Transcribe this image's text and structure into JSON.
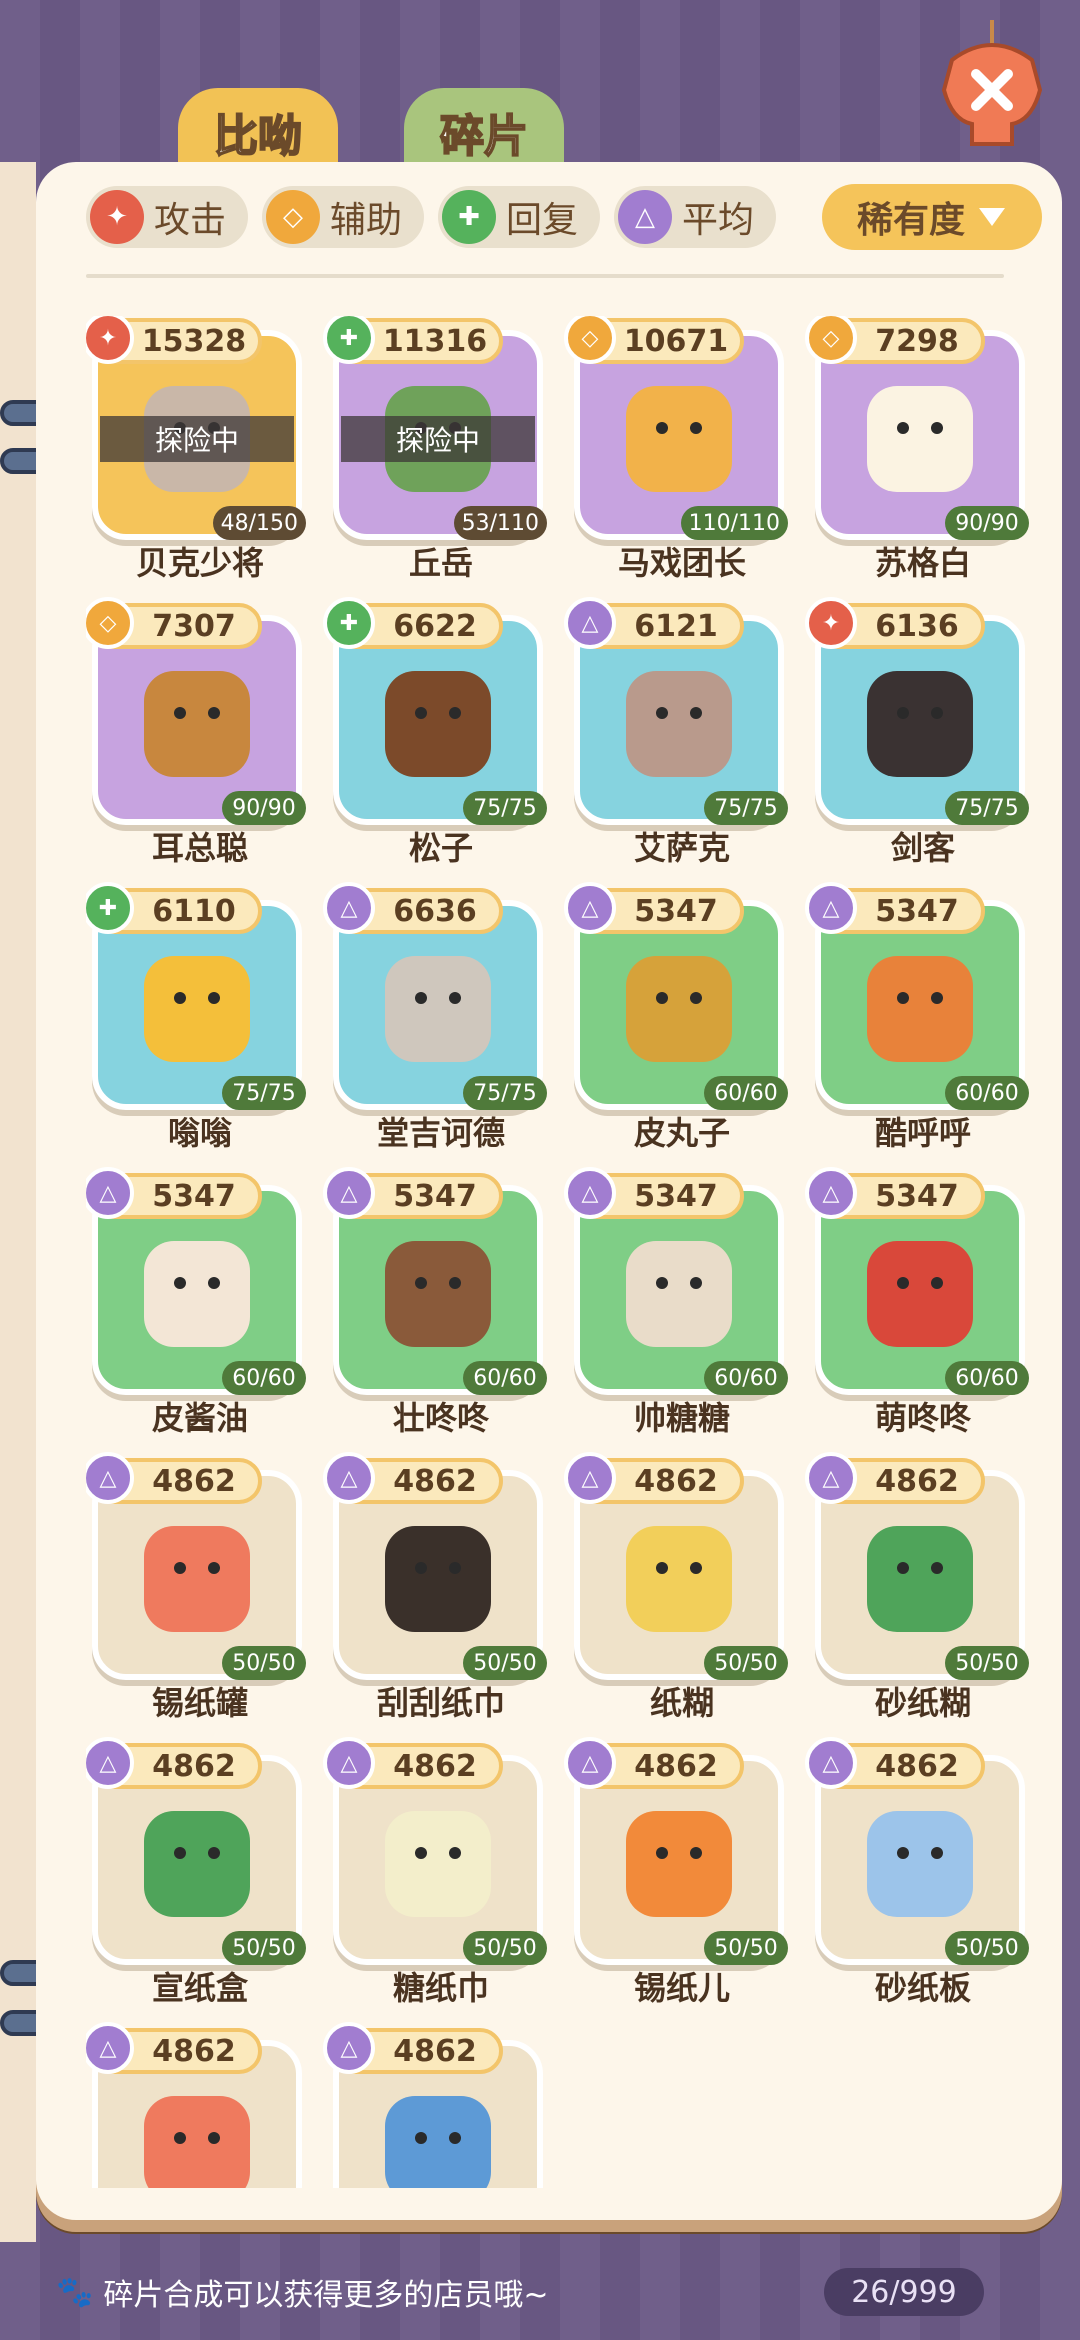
{
  "tabs": [
    {
      "label": "比呦"
    },
    {
      "label": "碎片"
    }
  ],
  "filters": [
    {
      "label": "攻击",
      "glyph": "✦",
      "color": "#e4604a"
    },
    {
      "label": "辅助",
      "glyph": "◇",
      "color": "#f0a83c"
    },
    {
      "label": "回复",
      "glyph": "✚",
      "color": "#55b25c"
    },
    {
      "label": "平均",
      "glyph": "△",
      "color": "#a17dd0"
    }
  ],
  "sort": {
    "label": "稀有度",
    "icon": "chevron-down-icon"
  },
  "close_icon": "close-icon",
  "type_colors": {
    "attack": "#e4604a",
    "support": "#f0a83c",
    "heal": "#55b25c",
    "balanced": "#a17dd0"
  },
  "type_glyphs": {
    "attack": "✦",
    "support": "◇",
    "heal": "✚",
    "balanced": "△"
  },
  "cards": [
    {
      "name": "贝克少将",
      "power": "15328",
      "type": "attack",
      "count": "48/150",
      "bg": "#f5c45a",
      "art": "#c9b7a8",
      "status": "探险中",
      "partial": true
    },
    {
      "name": "丘岳",
      "power": "11316",
      "type": "heal",
      "count": "53/110",
      "bg": "#c7a3e0",
      "art": "#6fa25a",
      "status": "探险中",
      "partial": true
    },
    {
      "name": "马戏团长",
      "power": "10671",
      "type": "support",
      "count": "110/110",
      "bg": "#c7a3e0",
      "art": "#f2b24a"
    },
    {
      "name": "苏格白",
      "power": "7298",
      "type": "support",
      "count": "90/90",
      "bg": "#c7a3e0",
      "art": "#fbf3e2"
    },
    {
      "name": "耳总聪",
      "power": "7307",
      "type": "support",
      "count": "90/90",
      "bg": "#c7a3e0",
      "art": "#c8873e"
    },
    {
      "name": "松子",
      "power": "6622",
      "type": "heal",
      "count": "75/75",
      "bg": "#86d3df",
      "art": "#7c4a2a"
    },
    {
      "name": "艾萨克",
      "power": "6121",
      "type": "balanced",
      "count": "75/75",
      "bg": "#86d3df",
      "art": "#b99a8c"
    },
    {
      "name": "剑客",
      "power": "6136",
      "type": "attack",
      "count": "75/75",
      "bg": "#86d3df",
      "art": "#3a3232"
    },
    {
      "name": "嗡嗡",
      "power": "6110",
      "type": "heal",
      "count": "75/75",
      "bg": "#86d3df",
      "art": "#f4bf3a"
    },
    {
      "name": "堂吉诃德",
      "power": "6636",
      "type": "balanced",
      "count": "75/75",
      "bg": "#86d3df",
      "art": "#cfc7bd"
    },
    {
      "name": "皮丸子",
      "power": "5347",
      "type": "balanced",
      "count": "60/60",
      "bg": "#7fce86",
      "art": "#d6a23a"
    },
    {
      "name": "酷呼呼",
      "power": "5347",
      "type": "balanced",
      "count": "60/60",
      "bg": "#7fce86",
      "art": "#e8823a"
    },
    {
      "name": "皮酱油",
      "power": "5347",
      "type": "balanced",
      "count": "60/60",
      "bg": "#7fce86",
      "art": "#f3e6d6"
    },
    {
      "name": "壮咚咚",
      "power": "5347",
      "type": "balanced",
      "count": "60/60",
      "bg": "#7fce86",
      "art": "#8a5a3a"
    },
    {
      "name": "帅糖糖",
      "power": "5347",
      "type": "balanced",
      "count": "60/60",
      "bg": "#7fce86",
      "art": "#e9dcc9"
    },
    {
      "name": "萌咚咚",
      "power": "5347",
      "type": "balanced",
      "count": "60/60",
      "bg": "#7fce86",
      "art": "#d9483a"
    },
    {
      "name": "锡纸罐",
      "power": "4862",
      "type": "balanced",
      "count": "50/50",
      "bg": "#efe2c9",
      "art": "#ef7a5e"
    },
    {
      "name": "刮刮纸巾",
      "power": "4862",
      "type": "balanced",
      "count": "50/50",
      "bg": "#efe2c9",
      "art": "#3a302a"
    },
    {
      "name": "纸糊",
      "power": "4862",
      "type": "balanced",
      "count": "50/50",
      "bg": "#efe2c9",
      "art": "#f2cf5a"
    },
    {
      "name": "砂纸糊",
      "power": "4862",
      "type": "balanced",
      "count": "50/50",
      "bg": "#efe2c9",
      "art": "#4fa45a"
    },
    {
      "name": "宣纸盒",
      "power": "4862",
      "type": "balanced",
      "count": "50/50",
      "bg": "#efe2c9",
      "art": "#4fa45a"
    },
    {
      "name": "糖纸巾",
      "power": "4862",
      "type": "balanced",
      "count": "50/50",
      "bg": "#efe2c9",
      "art": "#f3eecb"
    },
    {
      "name": "锡纸儿",
      "power": "4862",
      "type": "balanced",
      "count": "50/50",
      "bg": "#efe2c9",
      "art": "#f28a3a"
    },
    {
      "name": "砂纸板",
      "power": "4862",
      "type": "balanced",
      "count": "50/50",
      "bg": "#efe2c9",
      "art": "#9cc4ea"
    },
    {
      "name": "",
      "power": "4862",
      "type": "balanced",
      "count": "",
      "bg": "#efe2c9",
      "art": "#ef7a5e"
    },
    {
      "name": "",
      "power": "4862",
      "type": "balanced",
      "count": "",
      "bg": "#efe2c9",
      "art": "#5d9ad6"
    }
  ],
  "footer": {
    "tip": "碎片合成可以获得更多的店员哦~",
    "paw_icon": "paw-icon",
    "counter": "26/999"
  }
}
